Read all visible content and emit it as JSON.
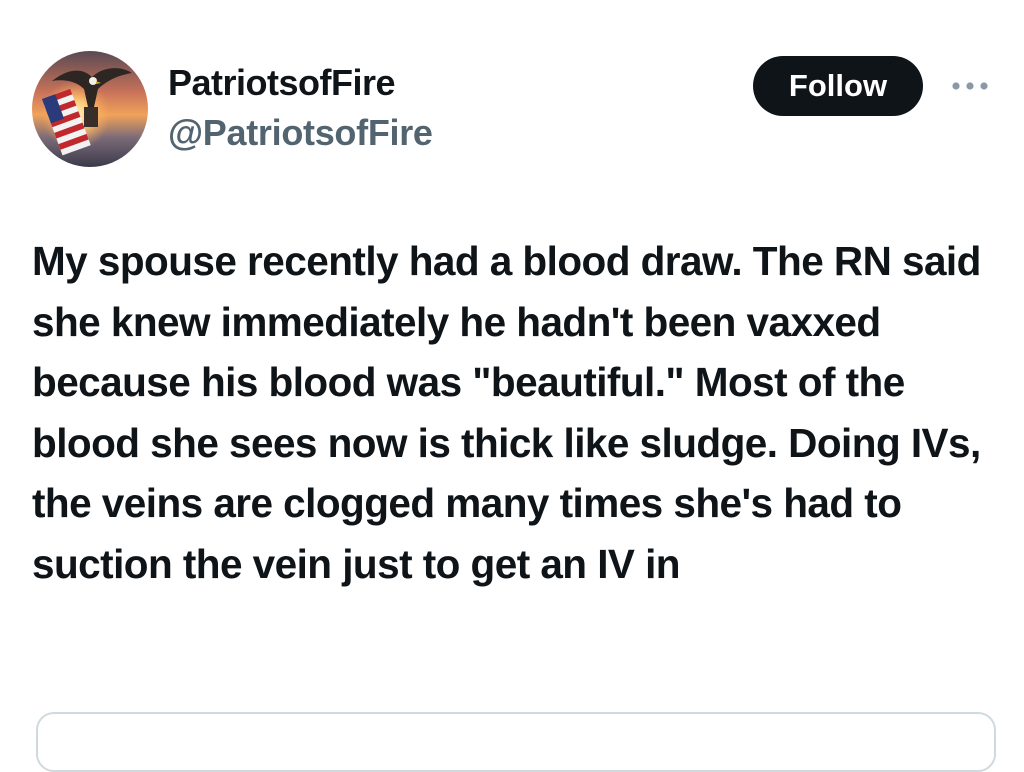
{
  "author": {
    "display_name": "PatriotsofFire",
    "handle": "@PatriotsofFire",
    "avatar_icon": "eagle-flag-sunset-avatar-icon"
  },
  "actions": {
    "follow_label": "Follow",
    "more_icon": "more-dots-icon"
  },
  "tweet": {
    "text": "My spouse recently had a blood draw. The RN said she knew immediately he hadn't been vaxxed because his blood was \"beautiful.\" Most of the blood she sees now is thick like sludge. Doing IVs, the veins are clogged many times she's had to suction the vein just to get an IV in"
  },
  "colors": {
    "text_primary": "#0f1419",
    "text_secondary": "#536471",
    "follow_bg": "#0f1419",
    "follow_text": "#ffffff",
    "border": "#cfd9de"
  }
}
